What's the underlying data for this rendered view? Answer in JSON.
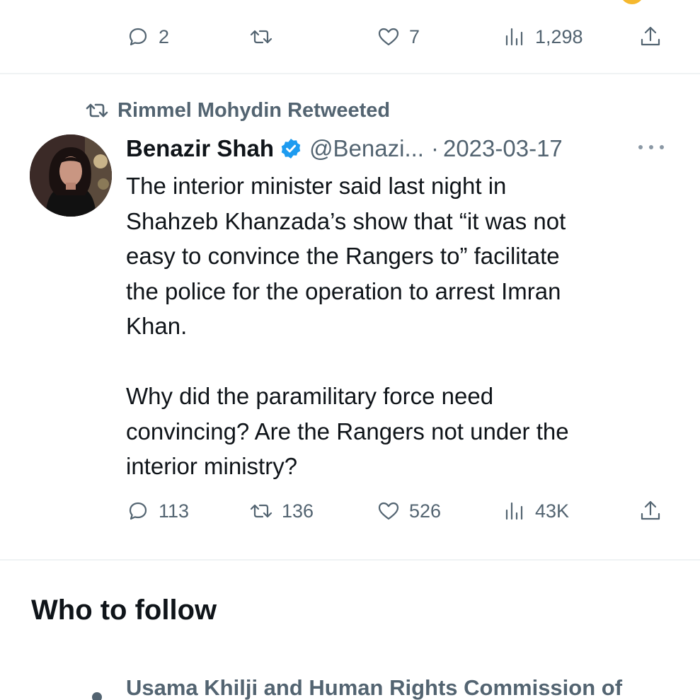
{
  "previous_tweet": {
    "actions": {
      "replies": "2",
      "retweets": "",
      "likes": "7",
      "views": "1,298"
    }
  },
  "retweet_context": {
    "label": "Rimmel Mohydin Retweeted"
  },
  "tweet": {
    "display_name": "Benazir Shah",
    "handle": "@Benazi...",
    "separator": "·",
    "date": "2023-03-17",
    "body_lines": [
      "The interior minister said last night in",
      "Shahzeb Khanzada’s show that “it was not",
      "easy to convince the Rangers to” facilitate",
      "the police for the operation to arrest Imran",
      "Khan.",
      "Why did the paramilitary force need",
      "convincing? Are the Rangers not under the",
      "interior ministry?"
    ],
    "actions": {
      "replies": "113",
      "retweets": "136",
      "likes": "526",
      "views": "43K"
    }
  },
  "who_to_follow": {
    "title": "Who to follow",
    "items": [
      {
        "text": "Usama Khilji and Human Rights Commission of"
      }
    ]
  },
  "colors": {
    "text_primary": "#0f1419",
    "text_secondary": "#536471",
    "verified_blue": "#1d9bf0",
    "divider": "#eff3f4"
  },
  "icons": {
    "reply": "reply-icon",
    "retweet": "retweet-icon",
    "like": "heart-icon",
    "views": "views-icon",
    "share": "share-icon",
    "verified": "verified-badge-icon",
    "more": "more-icon"
  }
}
